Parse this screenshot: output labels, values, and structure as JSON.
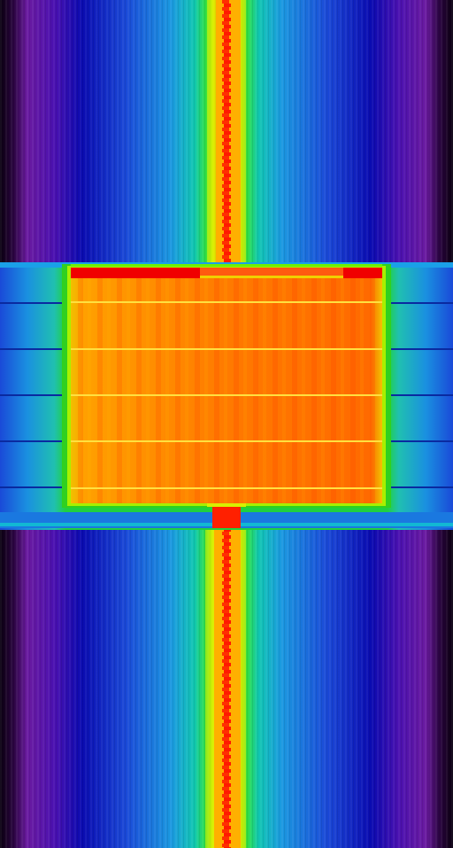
{
  "view": {
    "kind": "spectrogram-waterfall",
    "colormap": [
      "#000000",
      "#5a0a8a",
      "#7a1aa8",
      "#0c0ca8",
      "#1a3ad8",
      "#1a90e0",
      "#10c0d0",
      "#20d060",
      "#c8f000",
      "#ffd000",
      "#ff8c00",
      "#ff2000"
    ]
  }
}
